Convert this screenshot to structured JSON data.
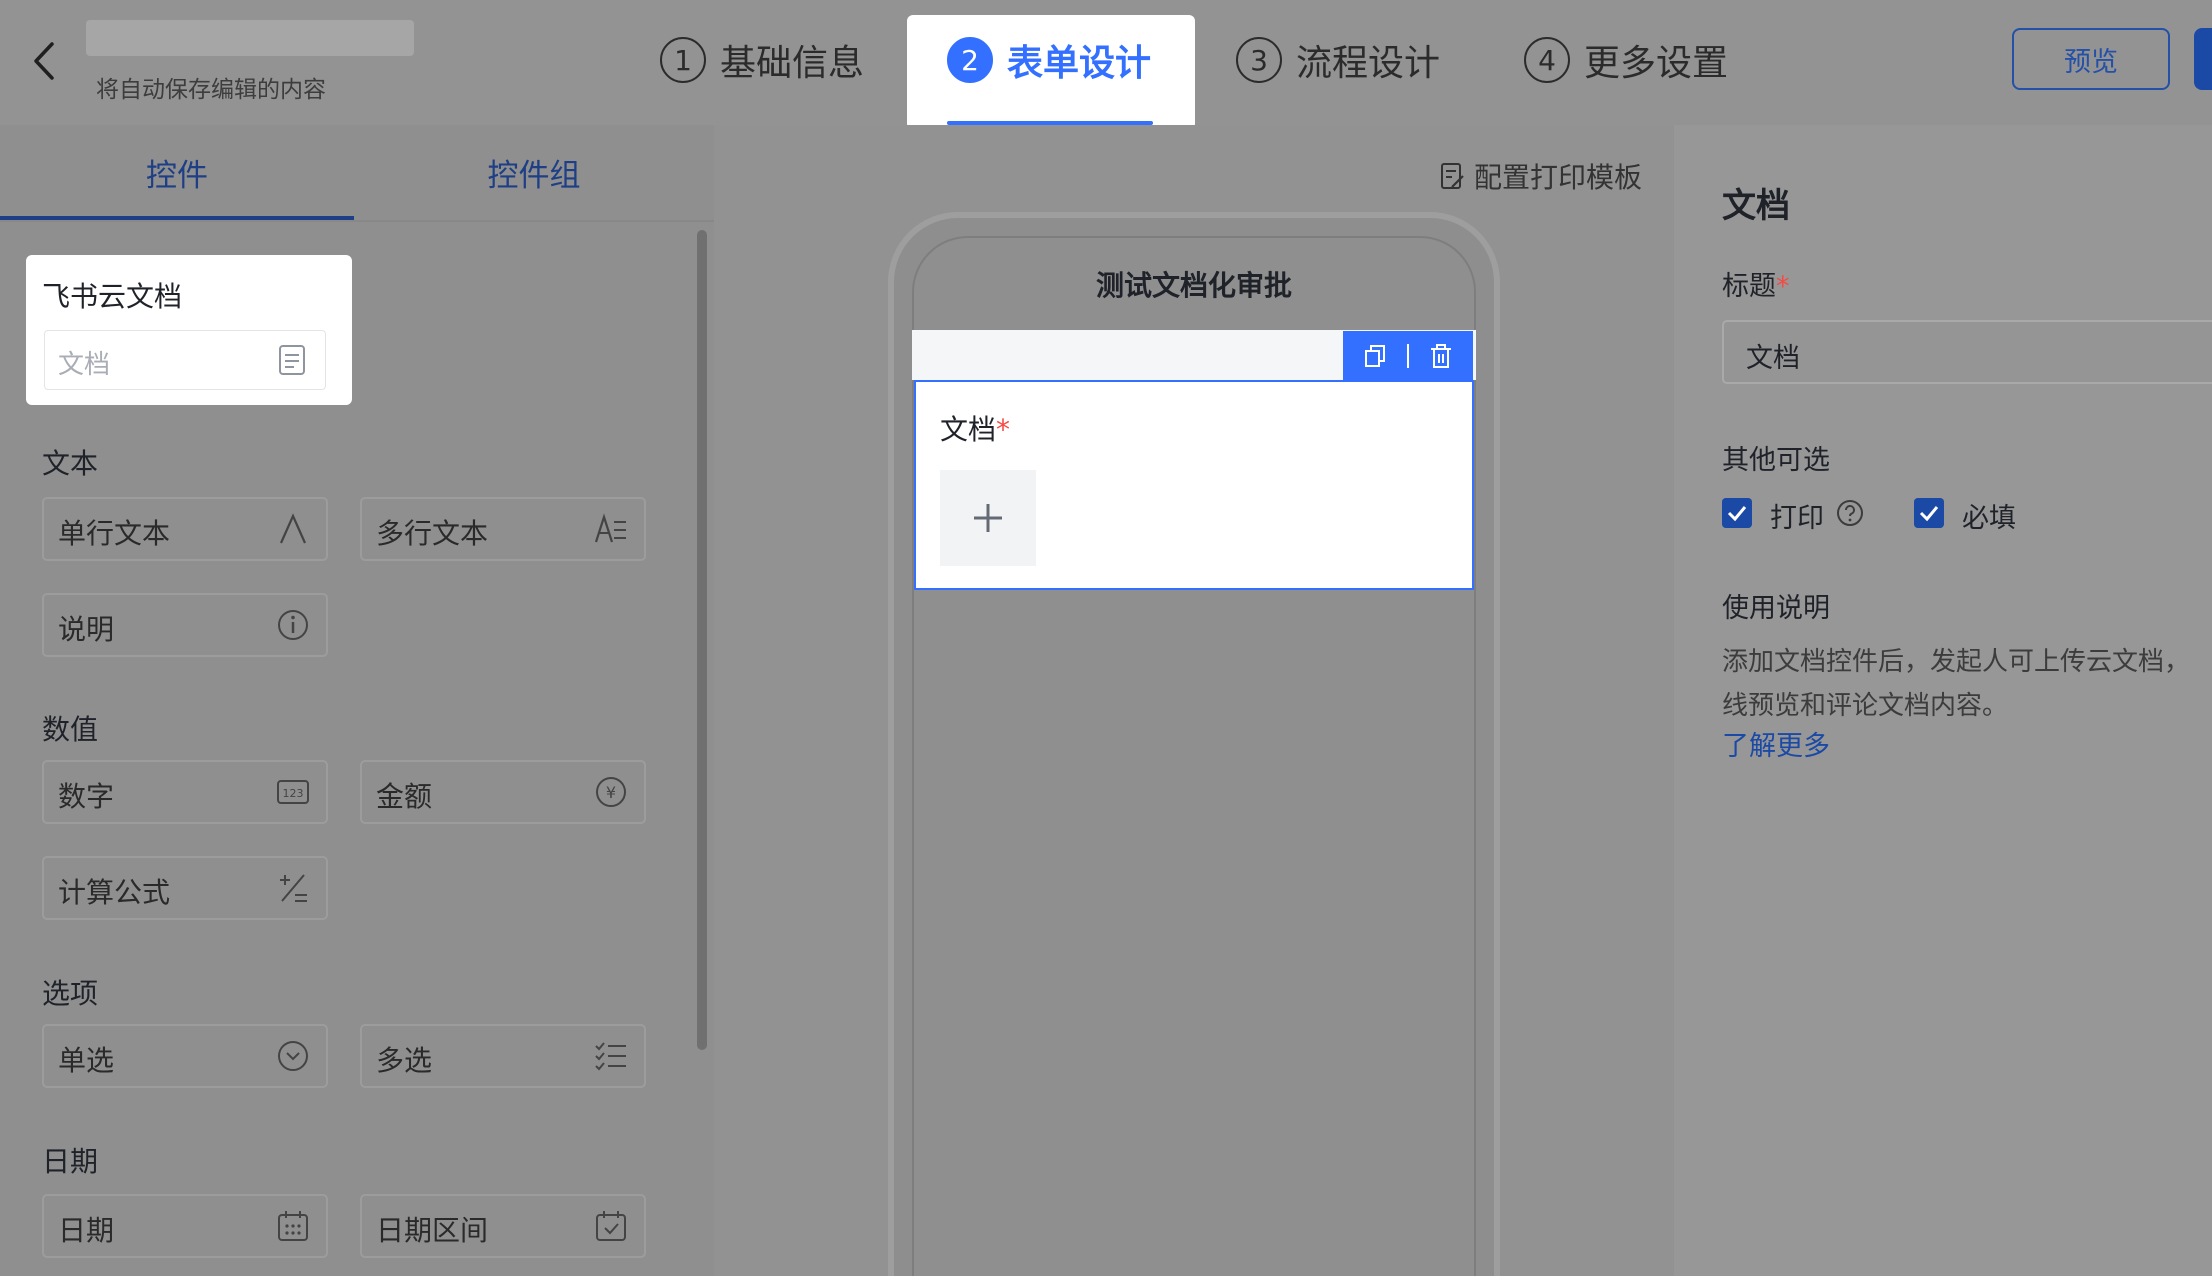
{
  "header": {
    "autosave_text": "将自动保存编辑的内容",
    "steps": [
      {
        "num": "1",
        "label": "基础信息"
      },
      {
        "num": "2",
        "label": "表单设计"
      },
      {
        "num": "3",
        "label": "流程设计"
      },
      {
        "num": "4",
        "label": "更多设置"
      }
    ],
    "active_step": 2,
    "preview_label": "预览"
  },
  "left_panel": {
    "tabs": [
      "控件",
      "控件组"
    ],
    "active_tab": "控件",
    "featured": {
      "title": "飞书云文档",
      "input_placeholder": "文档",
      "icon": "document-icon"
    },
    "sections": [
      {
        "title": "文本",
        "items": [
          {
            "label": "单行文本",
            "icon": "single-line-text-icon"
          },
          {
            "label": "多行文本",
            "icon": "multi-line-text-icon"
          },
          {
            "label": "说明",
            "icon": "info-icon"
          }
        ]
      },
      {
        "title": "数值",
        "items": [
          {
            "label": "数字",
            "icon": "number-icon"
          },
          {
            "label": "金额",
            "icon": "currency-icon"
          },
          {
            "label": "计算公式",
            "icon": "formula-icon"
          }
        ]
      },
      {
        "title": "选项",
        "items": [
          {
            "label": "单选",
            "icon": "single-select-icon"
          },
          {
            "label": "多选",
            "icon": "multi-select-icon"
          }
        ]
      },
      {
        "title": "日期",
        "items": [
          {
            "label": "日期",
            "icon": "calendar-icon"
          },
          {
            "label": "日期区间",
            "icon": "date-range-icon"
          }
        ]
      }
    ]
  },
  "canvas": {
    "print_template_label": "配置打印模板",
    "form_title": "测试文档化审批",
    "field": {
      "label": "文档",
      "required_mark": "*"
    }
  },
  "right_panel": {
    "heading": "文档",
    "title_label": "标题",
    "required_mark": "*",
    "title_value": "文档",
    "other_label": "其他可选",
    "options": [
      {
        "label": "打印",
        "checked": true
      },
      {
        "label": "必填",
        "checked": true
      }
    ],
    "usage_label": "使用说明",
    "usage_line1": "添加文档控件后，发起人可上传云文档，",
    "usage_line2": "线预览和评论文档内容。",
    "learn_more": "了解更多"
  },
  "colors": {
    "accent": "#3370ff",
    "dark_accent": "#1b4aa6",
    "required": "#f54a45"
  }
}
